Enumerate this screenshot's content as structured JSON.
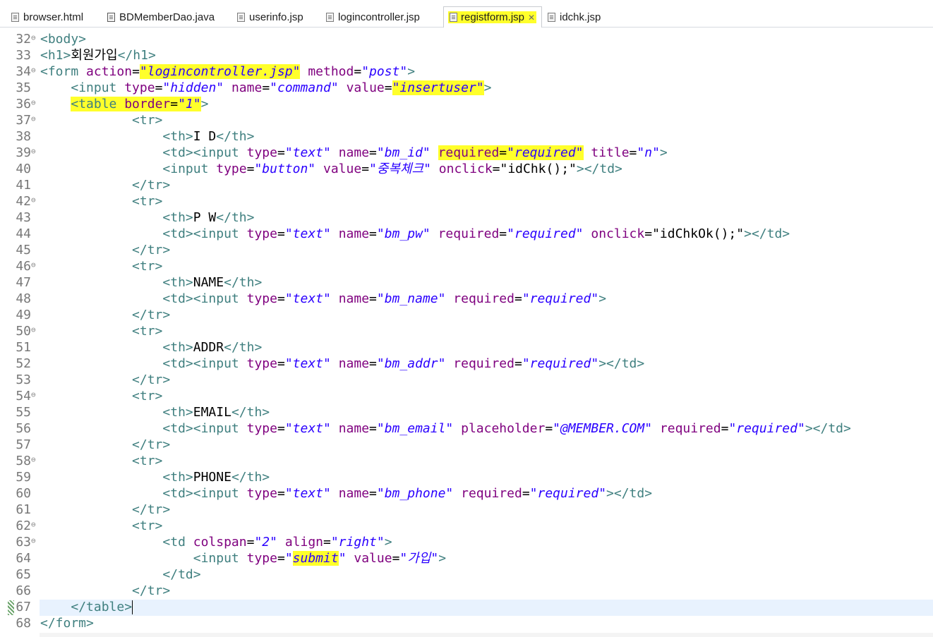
{
  "tabs": [
    {
      "label": "browser.html",
      "icon": "html-file-icon",
      "active": false
    },
    {
      "label": "BDMemberDao.java",
      "icon": "java-file-icon",
      "active": false
    },
    {
      "label": "userinfo.jsp",
      "icon": "jsp-file-icon",
      "active": false
    },
    {
      "label": "logincontroller.jsp",
      "icon": "jsp-file-icon",
      "active": false
    },
    {
      "label": "registform.jsp",
      "icon": "jsp-file-icon",
      "active": true,
      "close_glyph": "✕"
    },
    {
      "label": "idchk.jsp",
      "icon": "jsp-file-icon",
      "active": false
    }
  ],
  "editor": {
    "lines": [
      {
        "n": "32",
        "fold": true,
        "tokens": [
          [
            "t",
            "<body>"
          ]
        ]
      },
      {
        "n": "33",
        "tokens": [
          [
            "t",
            "<h1>"
          ],
          [
            "x",
            "회원가입"
          ],
          [
            "t",
            "</h1>"
          ]
        ]
      },
      {
        "n": "34",
        "fold": true,
        "tokens": [
          [
            "t",
            "<form "
          ],
          [
            "a",
            "action"
          ],
          [
            "x",
            "="
          ],
          [
            "vh",
            "\"logincontroller.jsp\""
          ],
          [
            "x",
            " "
          ],
          [
            "a",
            "method"
          ],
          [
            "x",
            "="
          ],
          [
            "v",
            "\"post\""
          ],
          [
            "t",
            ">"
          ]
        ]
      },
      {
        "n": "35",
        "tokens": [
          [
            "x",
            "    "
          ],
          [
            "t",
            "<input "
          ],
          [
            "a",
            "type"
          ],
          [
            "x",
            "="
          ],
          [
            "v",
            "\"hidden\""
          ],
          [
            "x",
            " "
          ],
          [
            "a",
            "name"
          ],
          [
            "x",
            "="
          ],
          [
            "v",
            "\"command\""
          ],
          [
            "x",
            " "
          ],
          [
            "a",
            "value"
          ],
          [
            "x",
            "="
          ],
          [
            "vh",
            "\"insertuser\""
          ],
          [
            "t",
            ">"
          ]
        ]
      },
      {
        "n": "36",
        "fold": true,
        "tokens": [
          [
            "x",
            "    "
          ],
          [
            "th",
            "<table "
          ],
          [
            "ah",
            "border"
          ],
          [
            "xh",
            "="
          ],
          [
            "vh",
            "\"1\""
          ],
          [
            "t",
            ">"
          ]
        ]
      },
      {
        "n": "37",
        "fold": true,
        "tokens": [
          [
            "x",
            "            "
          ],
          [
            "t",
            "<tr>"
          ]
        ]
      },
      {
        "n": "38",
        "tokens": [
          [
            "x",
            "                "
          ],
          [
            "t",
            "<th>"
          ],
          [
            "x",
            "I D"
          ],
          [
            "t",
            "</th>"
          ]
        ]
      },
      {
        "n": "39",
        "fold": true,
        "tokens": [
          [
            "x",
            "                "
          ],
          [
            "t",
            "<td><input "
          ],
          [
            "a",
            "type"
          ],
          [
            "x",
            "="
          ],
          [
            "v",
            "\"text\""
          ],
          [
            "x",
            " "
          ],
          [
            "a",
            "name"
          ],
          [
            "x",
            "="
          ],
          [
            "v",
            "\"bm_id\""
          ],
          [
            "x",
            " "
          ],
          [
            "ah",
            "required"
          ],
          [
            "xh",
            "="
          ],
          [
            "vh",
            "\"required\""
          ],
          [
            "x",
            " "
          ],
          [
            "a",
            "title"
          ],
          [
            "x",
            "="
          ],
          [
            "v",
            "\"n\""
          ],
          [
            "t",
            ">"
          ]
        ]
      },
      {
        "n": "40",
        "tokens": [
          [
            "x",
            "                "
          ],
          [
            "t",
            "<input "
          ],
          [
            "a",
            "type"
          ],
          [
            "x",
            "="
          ],
          [
            "v",
            "\"button\""
          ],
          [
            "x",
            " "
          ],
          [
            "a",
            "value"
          ],
          [
            "x",
            "="
          ],
          [
            "v",
            "\"중복체크\""
          ],
          [
            "x",
            " "
          ],
          [
            "a",
            "onclick"
          ],
          [
            "x",
            "="
          ],
          [
            "s",
            "\"idChk();\""
          ],
          [
            "t",
            "></td>"
          ]
        ]
      },
      {
        "n": "41",
        "tokens": [
          [
            "x",
            "            "
          ],
          [
            "t",
            "</tr>"
          ]
        ]
      },
      {
        "n": "42",
        "fold": true,
        "tokens": [
          [
            "x",
            "            "
          ],
          [
            "t",
            "<tr>"
          ]
        ]
      },
      {
        "n": "43",
        "tokens": [
          [
            "x",
            "                "
          ],
          [
            "t",
            "<th>"
          ],
          [
            "x",
            "P W"
          ],
          [
            "t",
            "</th>"
          ]
        ]
      },
      {
        "n": "44",
        "tokens": [
          [
            "x",
            "                "
          ],
          [
            "t",
            "<td><input "
          ],
          [
            "a",
            "type"
          ],
          [
            "x",
            "="
          ],
          [
            "v",
            "\"text\""
          ],
          [
            "x",
            " "
          ],
          [
            "a",
            "name"
          ],
          [
            "x",
            "="
          ],
          [
            "v",
            "\"bm_pw\""
          ],
          [
            "x",
            " "
          ],
          [
            "a",
            "required"
          ],
          [
            "x",
            "="
          ],
          [
            "v",
            "\"required\""
          ],
          [
            "x",
            " "
          ],
          [
            "a",
            "onclick"
          ],
          [
            "x",
            "="
          ],
          [
            "s",
            "\"idChkOk();\""
          ],
          [
            "t",
            "></td>"
          ]
        ]
      },
      {
        "n": "45",
        "tokens": [
          [
            "x",
            "            "
          ],
          [
            "t",
            "</tr>"
          ]
        ]
      },
      {
        "n": "46",
        "fold": true,
        "tokens": [
          [
            "x",
            "            "
          ],
          [
            "t",
            "<tr>"
          ]
        ]
      },
      {
        "n": "47",
        "tokens": [
          [
            "x",
            "                "
          ],
          [
            "t",
            "<th>"
          ],
          [
            "x",
            "NAME"
          ],
          [
            "t",
            "</th>"
          ]
        ]
      },
      {
        "n": "48",
        "tokens": [
          [
            "x",
            "                "
          ],
          [
            "t",
            "<td><input "
          ],
          [
            "a",
            "type"
          ],
          [
            "x",
            "="
          ],
          [
            "v",
            "\"text\""
          ],
          [
            "x",
            " "
          ],
          [
            "a",
            "name"
          ],
          [
            "x",
            "="
          ],
          [
            "v",
            "\"bm_name\""
          ],
          [
            "x",
            " "
          ],
          [
            "a",
            "required"
          ],
          [
            "x",
            "="
          ],
          [
            "v",
            "\"required\""
          ],
          [
            "t",
            ">"
          ]
        ]
      },
      {
        "n": "49",
        "tokens": [
          [
            "x",
            "            "
          ],
          [
            "t",
            "</tr>"
          ]
        ]
      },
      {
        "n": "50",
        "fold": true,
        "tokens": [
          [
            "x",
            "            "
          ],
          [
            "t",
            "<tr>"
          ]
        ]
      },
      {
        "n": "51",
        "tokens": [
          [
            "x",
            "                "
          ],
          [
            "t",
            "<th>"
          ],
          [
            "x",
            "ADDR"
          ],
          [
            "t",
            "</th>"
          ]
        ]
      },
      {
        "n": "52",
        "tokens": [
          [
            "x",
            "                "
          ],
          [
            "t",
            "<td><input "
          ],
          [
            "a",
            "type"
          ],
          [
            "x",
            "="
          ],
          [
            "v",
            "\"text\""
          ],
          [
            "x",
            " "
          ],
          [
            "a",
            "name"
          ],
          [
            "x",
            "="
          ],
          [
            "v",
            "\"bm_addr\""
          ],
          [
            "x",
            " "
          ],
          [
            "a",
            "required"
          ],
          [
            "x",
            "="
          ],
          [
            "v",
            "\"required\""
          ],
          [
            "t",
            "></td>"
          ]
        ]
      },
      {
        "n": "53",
        "tokens": [
          [
            "x",
            "            "
          ],
          [
            "t",
            "</tr>"
          ]
        ]
      },
      {
        "n": "54",
        "fold": true,
        "tokens": [
          [
            "x",
            "            "
          ],
          [
            "t",
            "<tr>"
          ]
        ]
      },
      {
        "n": "55",
        "tokens": [
          [
            "x",
            "                "
          ],
          [
            "t",
            "<th>"
          ],
          [
            "x",
            "EMAIL"
          ],
          [
            "t",
            "</th>"
          ]
        ]
      },
      {
        "n": "56",
        "tokens": [
          [
            "x",
            "                "
          ],
          [
            "t",
            "<td><input "
          ],
          [
            "a",
            "type"
          ],
          [
            "x",
            "="
          ],
          [
            "v",
            "\"text\""
          ],
          [
            "x",
            " "
          ],
          [
            "a",
            "name"
          ],
          [
            "x",
            "="
          ],
          [
            "v",
            "\"bm_email\""
          ],
          [
            "x",
            " "
          ],
          [
            "a",
            "placeholder"
          ],
          [
            "x",
            "="
          ],
          [
            "v",
            "\"@MEMBER.COM\""
          ],
          [
            "x",
            " "
          ],
          [
            "a",
            "required"
          ],
          [
            "x",
            "="
          ],
          [
            "v",
            "\"required\""
          ],
          [
            "t",
            "></td>"
          ]
        ]
      },
      {
        "n": "57",
        "tokens": [
          [
            "x",
            "            "
          ],
          [
            "t",
            "</tr>"
          ]
        ]
      },
      {
        "n": "58",
        "fold": true,
        "tokens": [
          [
            "x",
            "            "
          ],
          [
            "t",
            "<tr>"
          ]
        ]
      },
      {
        "n": "59",
        "tokens": [
          [
            "x",
            "                "
          ],
          [
            "t",
            "<th>"
          ],
          [
            "x",
            "PHONE"
          ],
          [
            "t",
            "</th>"
          ]
        ]
      },
      {
        "n": "60",
        "tokens": [
          [
            "x",
            "                "
          ],
          [
            "t",
            "<td><input "
          ],
          [
            "a",
            "type"
          ],
          [
            "x",
            "="
          ],
          [
            "v",
            "\"text\""
          ],
          [
            "x",
            " "
          ],
          [
            "a",
            "name"
          ],
          [
            "x",
            "="
          ],
          [
            "v",
            "\"bm_phone\""
          ],
          [
            "x",
            " "
          ],
          [
            "a",
            "required"
          ],
          [
            "x",
            "="
          ],
          [
            "v",
            "\"required\""
          ],
          [
            "t",
            "></td>"
          ]
        ]
      },
      {
        "n": "61",
        "tokens": [
          [
            "x",
            "            "
          ],
          [
            "t",
            "</tr>"
          ]
        ]
      },
      {
        "n": "62",
        "fold": true,
        "tokens": [
          [
            "x",
            "            "
          ],
          [
            "t",
            "<tr>"
          ]
        ]
      },
      {
        "n": "63",
        "fold": true,
        "tokens": [
          [
            "x",
            "                "
          ],
          [
            "t",
            "<td "
          ],
          [
            "a",
            "colspan"
          ],
          [
            "x",
            "="
          ],
          [
            "v",
            "\"2\""
          ],
          [
            "x",
            " "
          ],
          [
            "a",
            "align"
          ],
          [
            "x",
            "="
          ],
          [
            "v",
            "\"right\""
          ],
          [
            "t",
            ">"
          ]
        ]
      },
      {
        "n": "64",
        "tokens": [
          [
            "x",
            "                    "
          ],
          [
            "t",
            "<input "
          ],
          [
            "a",
            "type"
          ],
          [
            "x",
            "="
          ],
          [
            "v",
            "\""
          ],
          [
            "vh",
            "submit"
          ],
          [
            "v",
            "\""
          ],
          [
            "x",
            " "
          ],
          [
            "a",
            "value"
          ],
          [
            "x",
            "="
          ],
          [
            "v",
            "\"가입\""
          ],
          [
            "t",
            ">"
          ]
        ]
      },
      {
        "n": "65",
        "tokens": [
          [
            "x",
            "                "
          ],
          [
            "t",
            "</td>"
          ]
        ]
      },
      {
        "n": "66",
        "tokens": [
          [
            "x",
            "            "
          ],
          [
            "t",
            "</tr>"
          ]
        ]
      },
      {
        "n": "67",
        "current": true,
        "tokens": [
          [
            "x",
            "    "
          ],
          [
            "t",
            "</table>"
          ]
        ]
      },
      {
        "n": "68",
        "tokens": [
          [
            "t",
            "</form>"
          ]
        ]
      }
    ]
  },
  "colors": {
    "tag": "#3f7f7f",
    "attribute": "#7f007f",
    "value": "#2a00ff",
    "highlight": "#ffff2b",
    "current_line": "#e8f2fe"
  }
}
